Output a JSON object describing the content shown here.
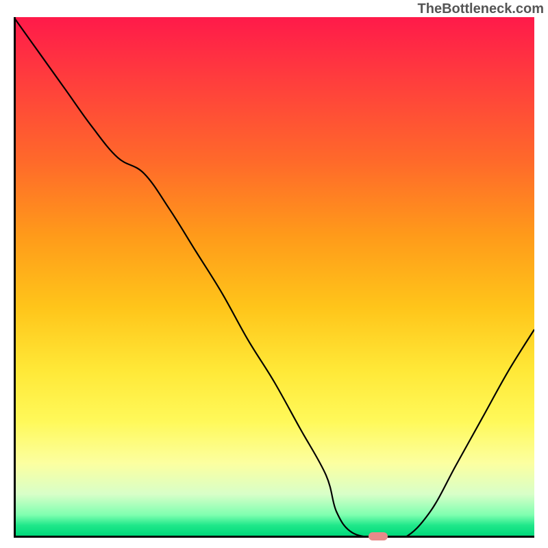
{
  "watermark": "TheBottleneck.com",
  "chart_data": {
    "type": "line",
    "title": "",
    "xlabel": "",
    "ylabel": "",
    "x": [
      0,
      5,
      10,
      15,
      20,
      25,
      30,
      35,
      40,
      45,
      50,
      55,
      60,
      62,
      65,
      70,
      75,
      80,
      85,
      90,
      95,
      100
    ],
    "y": [
      100,
      93,
      86,
      79,
      73,
      70,
      63,
      55,
      47,
      38,
      30,
      21,
      12,
      5,
      1,
      0,
      0,
      5,
      14,
      23,
      32,
      40
    ],
    "xlim": [
      0,
      100
    ],
    "ylim": [
      0,
      100
    ],
    "gradient_bands": [
      {
        "pos": 0.0,
        "color": "#ff1a4a"
      },
      {
        "pos": 0.12,
        "color": "#ff3d3d"
      },
      {
        "pos": 0.28,
        "color": "#ff6a2a"
      },
      {
        "pos": 0.42,
        "color": "#ff9a1a"
      },
      {
        "pos": 0.56,
        "color": "#ffc51a"
      },
      {
        "pos": 0.68,
        "color": "#ffe837"
      },
      {
        "pos": 0.78,
        "color": "#fff95a"
      },
      {
        "pos": 0.86,
        "color": "#fcffa0"
      },
      {
        "pos": 0.92,
        "color": "#d8ffc8"
      },
      {
        "pos": 0.96,
        "color": "#7fffb0"
      },
      {
        "pos": 0.98,
        "color": "#1fe88a"
      },
      {
        "pos": 1.0,
        "color": "#00d87a"
      }
    ],
    "valley_marker": {
      "x": 70,
      "y": 0,
      "color": "#e88a8a"
    }
  }
}
